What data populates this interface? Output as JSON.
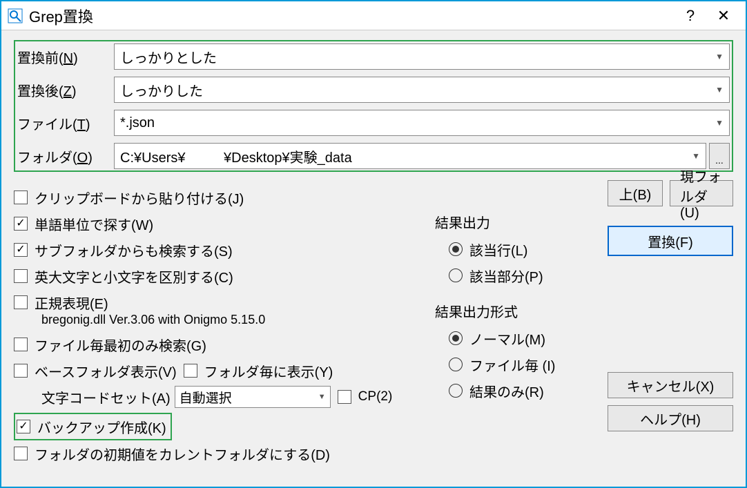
{
  "window": {
    "title": "Grep置換"
  },
  "fields": {
    "before_label": "置換前(",
    "before_key": "N",
    "before_suffix": ")",
    "before_value": "しっかりとした",
    "after_label": "置換後(",
    "after_key": "Z",
    "after_suffix": ")",
    "after_value": "しっかりした",
    "file_label": "ファイル(",
    "file_key": "T",
    "file_suffix": ")",
    "file_value": "*.json",
    "folder_label": "フォルダ(",
    "folder_key": "O",
    "folder_suffix": ")",
    "folder_value": "C:¥Users¥          ¥Desktop¥実験_data"
  },
  "checks": {
    "clip": "クリップボードから貼り付ける(J)",
    "word": "単語単位で探す(W)",
    "sub": "サブフォルダからも検索する(S)",
    "case": "英大文字と小文字を区別する(C)",
    "regex": "正規表現(E)",
    "regex_sub": "bregonig.dll Ver.3.06 with Onigmo 5.15.0",
    "first": "ファイル毎最初のみ検索(G)",
    "base": "ベースフォルダ表示(V)",
    "perfolder": "フォルダ毎に表示(Y)",
    "codeset_lbl": "文字コードセット(A)",
    "codeset_val": "自動選択",
    "cp": "CP(2)",
    "backup": "バックアップ作成(K)",
    "default": "フォルダの初期値をカレントフォルダにする(D)"
  },
  "output": {
    "group1": "結果出力",
    "line": "該当行(L)",
    "part": "該当部分(P)",
    "group2": "結果出力形式",
    "normal": "ノーマル(M)",
    "file": "ファイル毎 (I)",
    "result": "結果のみ(R)"
  },
  "buttons": {
    "up": "上(B)",
    "curfolder": "現フォルダ(U)",
    "replace": "置換(F)",
    "cancel": "キャンセル(X)",
    "help": "ヘルプ(H)",
    "browse": "..."
  }
}
